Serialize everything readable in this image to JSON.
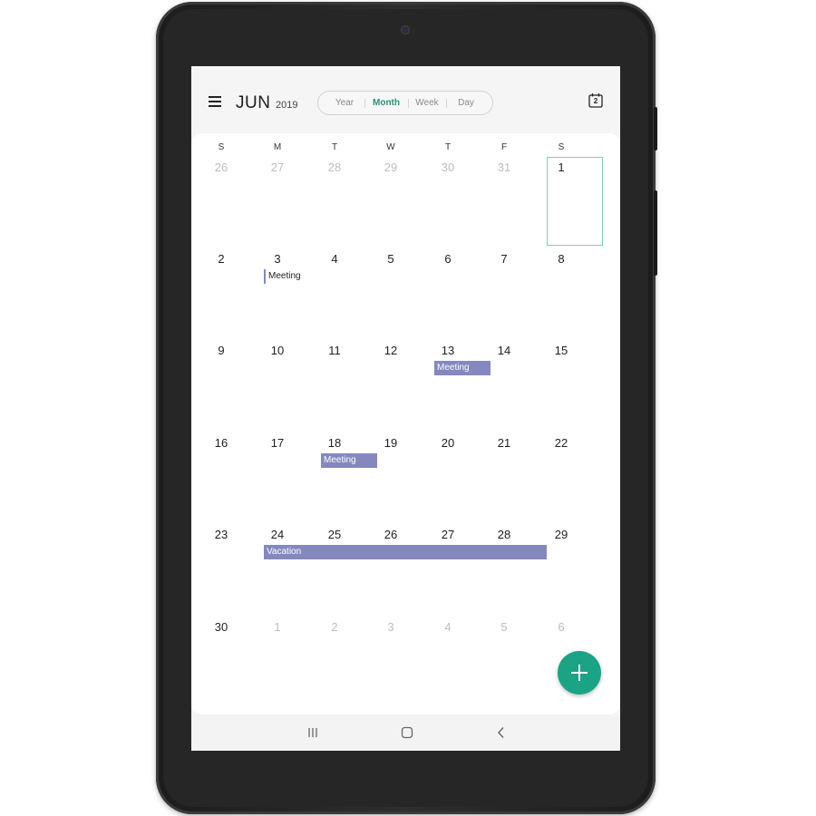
{
  "header": {
    "month": "JUN",
    "year": "2019",
    "views": [
      "Year",
      "Month",
      "Week",
      "Day"
    ],
    "active_view": "Month",
    "today_date": "2"
  },
  "calendar": {
    "weekdays": [
      "S",
      "M",
      "T",
      "W",
      "T",
      "F",
      "S"
    ],
    "weeks": [
      [
        "26",
        "27",
        "28",
        "29",
        "30",
        "31",
        "1"
      ],
      [
        "2",
        "3",
        "4",
        "5",
        "6",
        "7",
        "8"
      ],
      [
        "9",
        "10",
        "11",
        "12",
        "13",
        "14",
        "15"
      ],
      [
        "16",
        "17",
        "18",
        "19",
        "20",
        "21",
        "22"
      ],
      [
        "23",
        "24",
        "25",
        "26",
        "27",
        "28",
        "29"
      ],
      [
        "30",
        "1",
        "2",
        "3",
        "4",
        "5",
        "6"
      ]
    ],
    "events": [
      {
        "title": "Meeting",
        "date": "3"
      },
      {
        "title": "Meeting",
        "date": "13"
      },
      {
        "title": "Meeting",
        "date": "18"
      },
      {
        "title": "Vacation",
        "start": "24",
        "end": "28"
      }
    ]
  },
  "colors": {
    "accent": "#1aa385",
    "event": "#8588bf",
    "today_outline": "#7fcfb8"
  },
  "icons": {
    "menu": "hamburger-menu-icon",
    "today": "calendar-today-icon",
    "add": "plus-icon",
    "recents": "recent-apps-icon",
    "home": "home-icon",
    "back": "back-icon"
  }
}
